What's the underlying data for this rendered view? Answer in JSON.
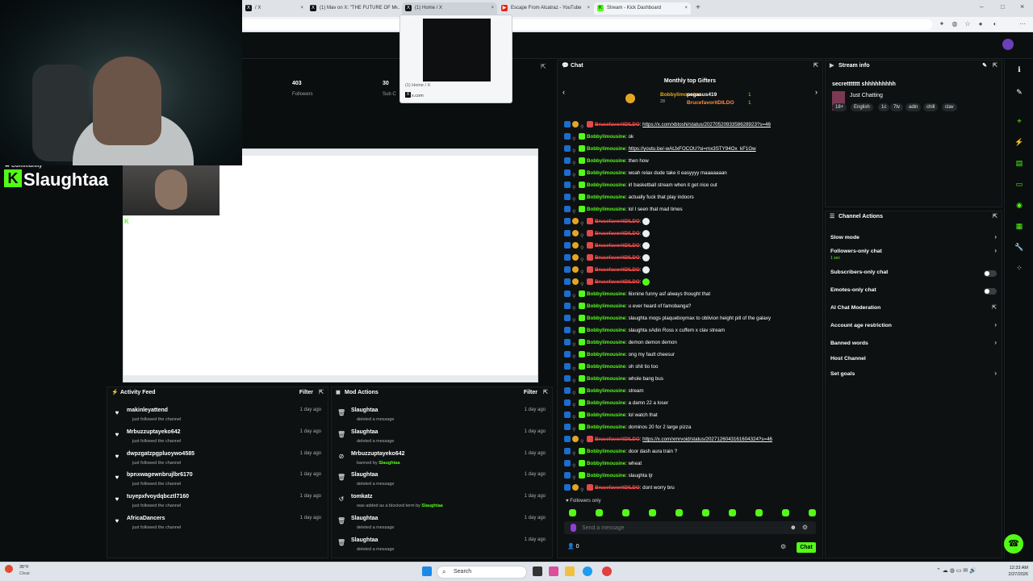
{
  "tabs": [
    {
      "label": "/ X",
      "icon": "x-icon"
    },
    {
      "label": "(1) Mav on X: \"THE FUTURE OF M...",
      "icon": "x-icon"
    },
    {
      "label": "(1) Home / X",
      "icon": "x-icon"
    },
    {
      "label": "Escape From Alcatraz - YouTube",
      "icon": "youtube-icon"
    },
    {
      "label": "Stream - Kick Dashboard",
      "icon": "kick-icon"
    }
  ],
  "tooltip": {
    "title": "(1) Home / X",
    "domain": "x.com"
  },
  "stats": [
    {
      "value": "403",
      "label": "Followers"
    },
    {
      "value": "30",
      "label": "Sub C"
    }
  ],
  "brand": {
    "community": "Community",
    "name": "Slaughtaa",
    "pip_label": "Slaughtaa"
  },
  "activity_feed": {
    "title": "Activity Feed",
    "filter": "Filter",
    "items": [
      {
        "name": "makinleyattend",
        "desc": "just followed the channel",
        "ago": "1 day ago"
      },
      {
        "name": "Mrbuzzuptayeko642",
        "desc": "just followed the channel",
        "ago": "1 day ago"
      },
      {
        "name": "dwpzgatzpgpluoywo4585",
        "desc": "just followed the channel",
        "ago": "1 day ago"
      },
      {
        "name": "bpnxwagewnbrujlbr6170",
        "desc": "just followed the channel",
        "ago": "1 day ago"
      },
      {
        "name": "tuyepxfvoydqbcztl7160",
        "desc": "just followed the channel",
        "ago": "1 day ago"
      },
      {
        "name": "AfricaDancers",
        "desc": "just followed the channel",
        "ago": "1 day ago"
      }
    ]
  },
  "mod_actions": {
    "title": "Mod Actions",
    "filter": "Filter",
    "items": [
      {
        "name": "Slaughtaa",
        "desc": "deleted a message",
        "extra": "",
        "ago": "1 day ago"
      },
      {
        "name": "Slaughtaa",
        "desc": "deleted a message",
        "extra": "",
        "ago": "1 day ago"
      },
      {
        "name": "Mrbuzzuptayeko642",
        "desc": "banned by",
        "extra": "Slaughtaa",
        "ago": "1 day ago"
      },
      {
        "name": "Slaughtaa",
        "desc": "deleted a message",
        "extra": "",
        "ago": "1 day ago"
      },
      {
        "name": "tomkatz",
        "desc": "was added as a blocked term by",
        "extra": "Slaughtaa",
        "ago": "1 day ago"
      },
      {
        "name": "Slaughtaa",
        "desc": "deleted a message",
        "extra": "",
        "ago": "1 day ago"
      },
      {
        "name": "Slaughtaa",
        "desc": "deleted a message",
        "extra": "",
        "ago": "1 day ago"
      }
    ]
  },
  "chat": {
    "title": "Chat",
    "gifters_title": "Monthly top Gifters",
    "gifters": [
      {
        "name": "Bobbylimousine",
        "count": "28"
      },
      {
        "name": "pegasus419",
        "count": "1"
      },
      {
        "name": "BrucefavoritDILDO",
        "count": "1"
      }
    ],
    "lines": [
      {
        "user": "BrucefavoritDILDO",
        "type": "u2",
        "msg": "https://x.com/xbtoshi/status/2027052093358628923?s=46",
        "link": true
      },
      {
        "user": "Bobbylimousine",
        "type": "u1",
        "msg": "ok",
        "link": false
      },
      {
        "user": "Bobbylimousine",
        "type": "u1",
        "msg": "https://youtu.be/-wAtJxFOCOU?si=mx3STY94Ox_kF1Gw",
        "link": true
      },
      {
        "user": "Bobbylimousine",
        "type": "u1",
        "msg": "then how",
        "link": false
      },
      {
        "user": "Bobbylimousine",
        "type": "u1",
        "msg": "woah relax dude take it easyyyy maaaaaaan",
        "link": false
      },
      {
        "user": "Bobbylimousine",
        "type": "u1",
        "msg": "irl basketball stream when it get nice out",
        "link": false
      },
      {
        "user": "Bobbylimousine",
        "type": "u1",
        "msg": "actually fuck that play indoors",
        "link": false
      },
      {
        "user": "Bobbylimousine",
        "type": "u1",
        "msg": "lol I seen that mad times",
        "link": false
      },
      {
        "user": "BrucefavoritDILDO",
        "type": "u2",
        "msg": "",
        "emote": true
      },
      {
        "user": "BrucefavoritDILDO",
        "type": "u2",
        "msg": "",
        "emote": true
      },
      {
        "user": "BrucefavoritDILDO",
        "type": "u2",
        "msg": "",
        "emote": true
      },
      {
        "user": "BrucefavoritDILDO",
        "type": "u2",
        "msg": "",
        "emote": true
      },
      {
        "user": "BrucefavoritDILDO",
        "type": "u2",
        "msg": "",
        "emote": true
      },
      {
        "user": "BrucefavoritDILDO",
        "type": "u2",
        "msg": "",
        "emote": true
      },
      {
        "user": "Bobbylimousine",
        "type": "u1",
        "msg": "6ixnine funny asf always thought that",
        "link": false
      },
      {
        "user": "Bobbylimousine",
        "type": "u1",
        "msg": "u ever heard of famobanga?",
        "link": false
      },
      {
        "user": "Bobbylimousine",
        "type": "u1",
        "msg": "slaughta mogs plaqueboymax to oblivion height pill of the galaxy",
        "link": false
      },
      {
        "user": "Bobbylimousine",
        "type": "u1",
        "msg": "slaughta xAdin Ross x cuffem x clav stream",
        "link": false
      },
      {
        "user": "Bobbylimousine",
        "type": "u1",
        "msg": "demon demon demon",
        "link": false
      },
      {
        "user": "Bobbylimousine",
        "type": "u1",
        "msg": "ong my fault cheesur",
        "link": false
      },
      {
        "user": "Bobbylimousine",
        "type": "u1",
        "msg": "oh shit tio too",
        "link": false
      },
      {
        "user": "Bobbylimousine",
        "type": "u1",
        "msg": "whole bang bus",
        "link": false
      },
      {
        "user": "Bobbylimousine",
        "type": "u1",
        "msg": "stream",
        "link": false
      },
      {
        "user": "Bobbylimousine",
        "type": "u1",
        "msg": "a damn 22 a loser",
        "link": false
      },
      {
        "user": "Bobbylimousine",
        "type": "u1",
        "msg": "lol watch that",
        "link": false
      },
      {
        "user": "Bobbylimousine",
        "type": "u1",
        "msg": "dominos 20 for 2 large pizza",
        "link": false
      },
      {
        "user": "BrucefavoritDILDO",
        "type": "u2",
        "msg": "https://x.com/xmrvoid/status/2027126043161604324?s=46",
        "link": true
      },
      {
        "user": "Bobbylimousine",
        "type": "u1",
        "msg": "door dash aura train ?",
        "link": false
      },
      {
        "user": "Bobbylimousine",
        "type": "u1",
        "msg": "wheat",
        "link": false
      },
      {
        "user": "Bobbylimousine",
        "type": "u1",
        "msg": "slaughta tjr",
        "link": false
      },
      {
        "user": "BrucefavoritDILDO",
        "type": "u2",
        "msg": "dont worry bru",
        "link": false
      }
    ],
    "followers_only": "Followers only",
    "input_placeholder": "Send a message",
    "viewer_count": "0",
    "send_label": "Chat"
  },
  "stream_info": {
    "title": "Stream info",
    "stream_title": "secrettttttt shhhhhhhhh",
    "category": "Just Chatting",
    "tags": [
      "18+",
      "English",
      "1c",
      "7tv",
      "adin",
      "chill",
      "clav"
    ]
  },
  "channel_actions": {
    "title": "Channel Actions",
    "items": [
      {
        "label": "Slow mode",
        "control": "arrow",
        "sub": ""
      },
      {
        "label": "Followers-only chat",
        "control": "arrow",
        "sub": "1 sec"
      },
      {
        "label": "Subscribers-only chat",
        "control": "toggle",
        "sub": ""
      },
      {
        "label": "Emotes-only chat",
        "control": "toggle",
        "sub": ""
      },
      {
        "label": "AI Chat Moderation",
        "control": "popout",
        "sub": ""
      },
      {
        "label": "Account age restriction",
        "control": "arrow",
        "sub": ""
      },
      {
        "label": "Banned words",
        "control": "arrow",
        "sub": ""
      },
      {
        "label": "Host Channel",
        "control": "none",
        "sub": ""
      },
      {
        "label": "Set goals",
        "control": "arrow",
        "sub": ""
      }
    ]
  },
  "taskbar": {
    "weather_temp": "35°F",
    "weather_desc": "Clear",
    "search_label": "Search",
    "time": "12:33 AM",
    "date": "2/27/2026"
  },
  "colors": {
    "accent": "#53fc18",
    "background": "#0b0e0f",
    "panel": "#0e1112"
  }
}
